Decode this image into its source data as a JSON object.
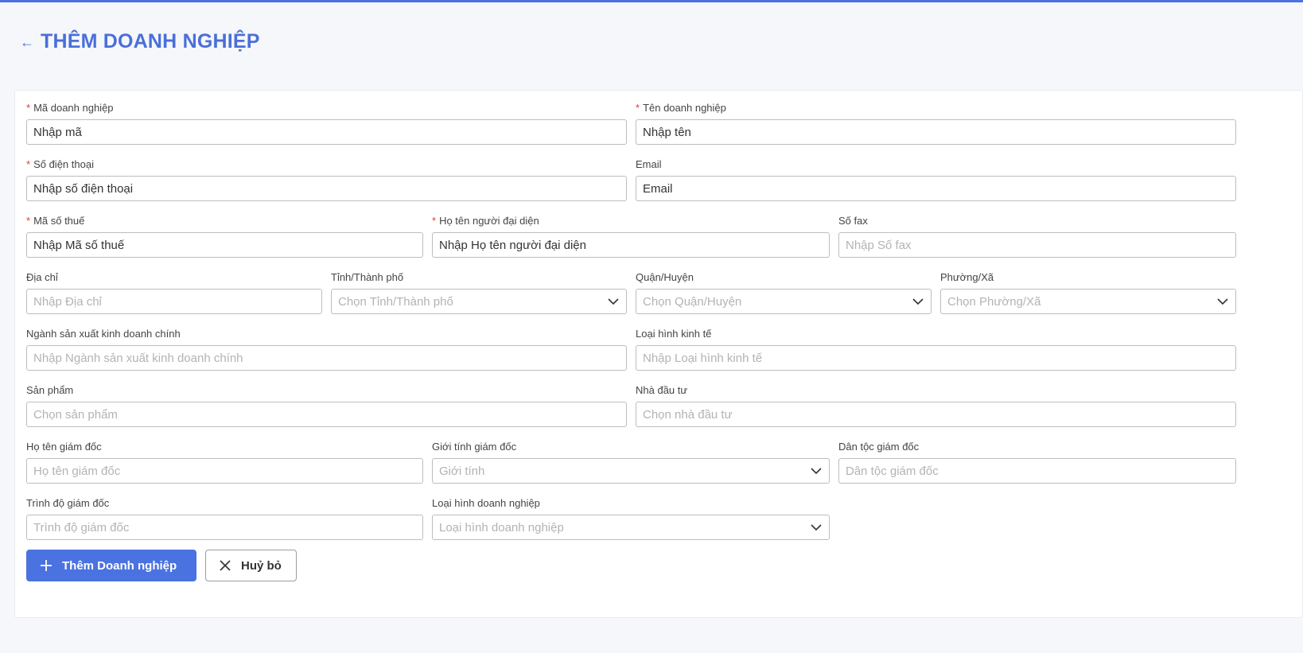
{
  "header": {
    "title": "THÊM DOANH NGHIỆP",
    "back_icon": "arrow-left-icon"
  },
  "form": {
    "ma_dn": {
      "label": "Mã doanh nghiệp",
      "required": true,
      "value": "Nhập mã"
    },
    "ten_dn": {
      "label": "Tên doanh nghiệp",
      "required": true,
      "value": "Nhập tên"
    },
    "sdt": {
      "label": "Số điện thoại",
      "required": true,
      "value": "Nhập số điện thoại"
    },
    "email": {
      "label": "Email",
      "value": "Email"
    },
    "mst": {
      "label": "Mã số thuế",
      "required": true,
      "value": "Nhập Mã số thuế"
    },
    "nguoi_dai_dien": {
      "label": "Họ tên người đại diện",
      "required": true,
      "value": "Nhập Họ tên người đại diện"
    },
    "fax": {
      "label": "Số fax",
      "placeholder": "Nhập Số fax"
    },
    "dia_chi": {
      "label": "Địa chỉ",
      "placeholder": "Nhập Địa chỉ"
    },
    "tinh": {
      "label": "Tỉnh/Thành phố",
      "placeholder": "Chọn Tỉnh/Thành phố"
    },
    "quan": {
      "label": "Quận/Huyện",
      "placeholder": "Chọn Quận/Huyện"
    },
    "phuong": {
      "label": "Phường/Xã",
      "placeholder": "Chọn Phường/Xã"
    },
    "nganh": {
      "label": "Ngành sản xuất kinh doanh chính",
      "placeholder": "Nhập Ngành sản xuất kinh doanh chính"
    },
    "loai_kt": {
      "label": "Loại hình kinh tế",
      "placeholder": "Nhập Loại hình kinh tế"
    },
    "san_pham": {
      "label": "Sản phẩm",
      "placeholder": "Chọn sản phẩm"
    },
    "nha_dau_tu": {
      "label": "Nhà đầu tư",
      "placeholder": "Chọn nhà đầu tư"
    },
    "ho_ten_gd": {
      "label": "Họ tên giám đốc",
      "placeholder": "Họ tên giám đốc"
    },
    "gioi_tinh_gd": {
      "label": "Giới tính giám đốc",
      "placeholder": "Giới tính"
    },
    "dan_toc_gd": {
      "label": "Dân tộc giám đốc",
      "placeholder": "Dân tộc giám đốc"
    },
    "trinh_do_gd": {
      "label": "Trình độ giám đốc",
      "placeholder": "Trình độ giám đốc"
    },
    "loai_dn": {
      "label": "Loại hình doanh nghiệp",
      "placeholder": "Loại hình doanh nghiệp"
    }
  },
  "actions": {
    "add_label": "Thêm Doanh nghiệp",
    "add_icon": "plus-icon",
    "cancel_label": "Huỷ bỏ",
    "cancel_icon": "close-icon"
  },
  "colors": {
    "accent": "#4a72e0",
    "required": "#e53935"
  }
}
